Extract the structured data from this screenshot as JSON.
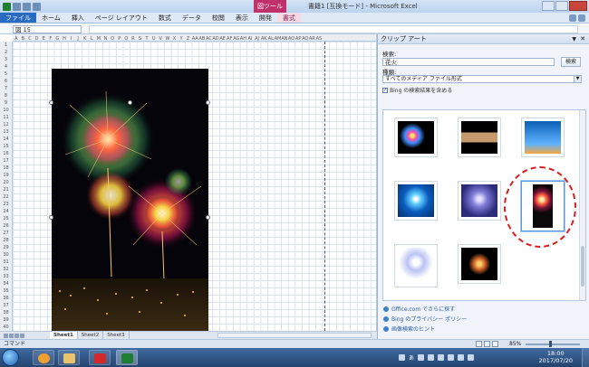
{
  "window": {
    "context_tab": "図ツール",
    "title": "書籍1 [互換モード] - Microsoft Excel"
  },
  "ribbon": {
    "tabs": [
      "ファイル",
      "ホーム",
      "挿入",
      "ページ レイアウト",
      "数式",
      "データ",
      "校閲",
      "表示",
      "開発",
      "書式"
    ]
  },
  "formula_bar": {
    "name_box": "図 15",
    "formula": ""
  },
  "sheet": {
    "columns": [
      "A",
      "B",
      "C",
      "D",
      "E",
      "F",
      "G",
      "H",
      "I",
      "J",
      "K",
      "L",
      "M",
      "N",
      "O",
      "P",
      "Q",
      "R",
      "S",
      "T",
      "U",
      "V",
      "W",
      "X",
      "Y",
      "Z",
      "AA",
      "AB",
      "AC",
      "AD",
      "AE",
      "AF",
      "AG",
      "AH",
      "AI",
      "AJ",
      "AK",
      "AL",
      "AM",
      "AN",
      "AO",
      "AP",
      "AQ",
      "AR",
      "AS"
    ],
    "rows": [
      "1",
      "2",
      "3",
      "4",
      "5",
      "6",
      "7",
      "8",
      "9",
      "10",
      "11",
      "12",
      "13",
      "14",
      "15",
      "16",
      "17",
      "18",
      "19",
      "20",
      "21",
      "22",
      "23",
      "24",
      "25",
      "26",
      "27",
      "28",
      "29",
      "30",
      "31",
      "32",
      "33",
      "34",
      "35",
      "36",
      "37",
      "38",
      "39",
      "40"
    ],
    "tabs": [
      "Sheet1",
      "Sheet2",
      "Sheet3"
    ]
  },
  "clipart_pane": {
    "title": "クリップ アート",
    "search_label": "検索:",
    "search_value": "花火",
    "search_button": "検索",
    "type_label": "種類:",
    "type_value": "すべてのメディア ファイル形式",
    "bing_checkbox": "Bing の検索結果を含める",
    "bing_checked": true,
    "links": [
      "Office.com でさらに探す",
      "Bing のプライバシー ポリシー",
      "画像検索のヒント"
    ]
  },
  "status_bar": {
    "mode": "コマンド",
    "zoom": "85%"
  },
  "taskbar": {
    "tray_text": "あ",
    "time": "18:00",
    "date": "2017/07/20"
  },
  "colors": {
    "file_tab": "#2a6bc2",
    "context_tab": "#c0306a",
    "highlight_circle": "#d81f1f"
  }
}
